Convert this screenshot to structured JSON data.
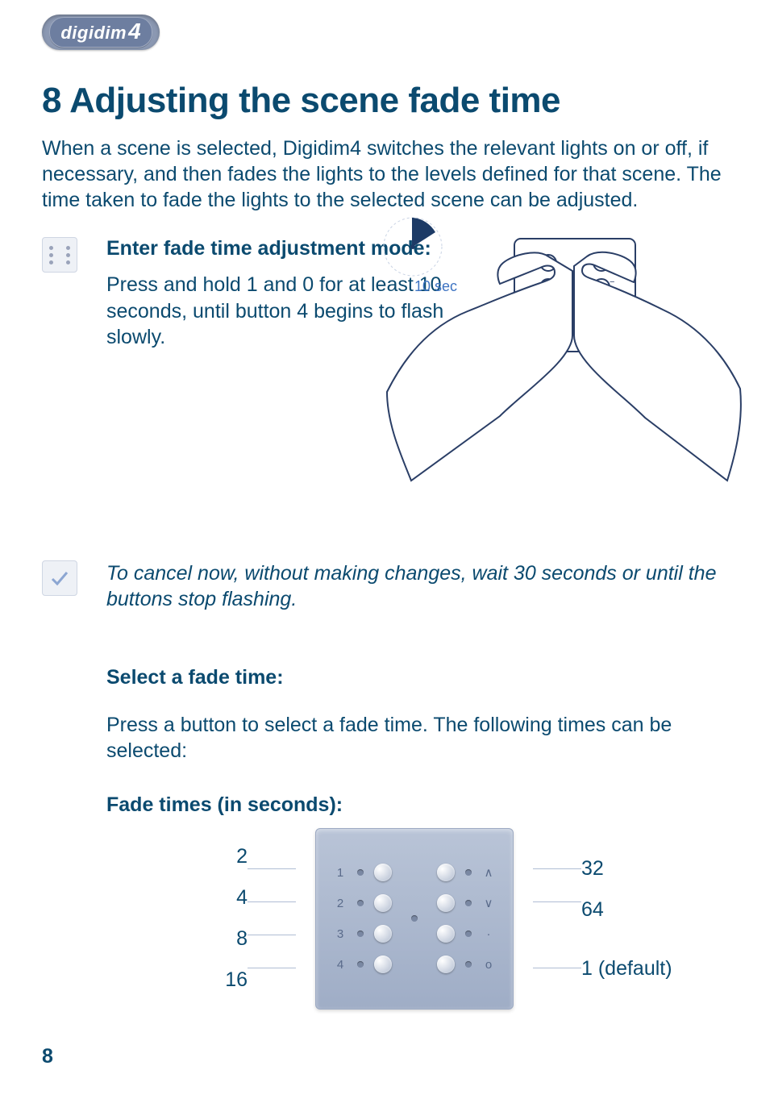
{
  "header": {
    "logo_text": "digidim",
    "logo_accent": "4"
  },
  "title": "8 Adjusting the scene fade time",
  "intro": "When a scene is selected, Digidim4 switches the relevant lights on or off, if necessary, and then fades the lights to the levels defined for that scene. The time taken to fade the lights to the selected scene can be adjusted.",
  "steps": {
    "enter_mode": {
      "title": "Enter fade time adjustment mode:",
      "text": "Press and hold 1 and 0 for at least 10 seconds, until button 4 begins to flash slowly.",
      "illustration_label": "10 sec"
    },
    "cancel_tip": "To cancel now, without making changes, wait 30 seconds or until the buttons stop flashing.",
    "select": {
      "title": "Select a fade time:",
      "text": "Press a button to select a fade time. The following times can be selected:"
    },
    "table_title": "Fade times (in seconds):"
  },
  "fade_times": {
    "left": [
      "2",
      "4",
      "8",
      "16"
    ],
    "right": [
      "32",
      "64",
      "",
      "1 (default)"
    ],
    "panel_rows": [
      {
        "left": "1",
        "right": "∧"
      },
      {
        "left": "2",
        "right": "∨"
      },
      {
        "left": "3",
        "right": "·"
      },
      {
        "left": "4",
        "right": "o"
      }
    ]
  },
  "page_number": "8"
}
